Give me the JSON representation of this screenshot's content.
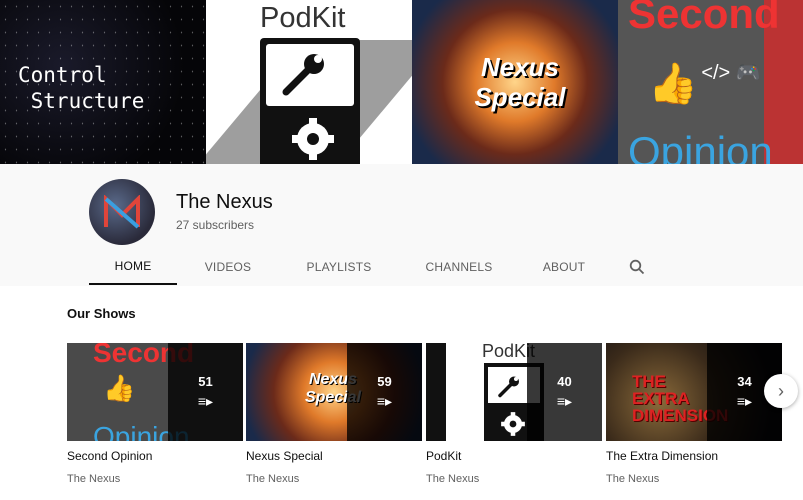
{
  "banner": {
    "tile1_text": "Control\n Structure",
    "tile2_text": "PodKit",
    "tile3_text": "Nexus Special",
    "tile4_top": "Second",
    "tile4_bottom": "Opinion",
    "tile4_icons": "</> 🎮"
  },
  "channel": {
    "name": "The Nexus",
    "subscribers": "27 subscribers"
  },
  "tabs": [
    {
      "label": "HOME"
    },
    {
      "label": "VIDEOS"
    },
    {
      "label": "PLAYLISTS"
    },
    {
      "label": "CHANNELS"
    },
    {
      "label": "ABOUT"
    }
  ],
  "section": {
    "title": "Our Shows"
  },
  "shows": [
    {
      "title": "Second Opinion",
      "channel": "The Nexus",
      "count": "51",
      "thumb_top": "Second",
      "thumb_bottom": "Opinion",
      "thumb_icons": "</> 🎮"
    },
    {
      "title": "Nexus Special",
      "channel": "The Nexus",
      "count": "59",
      "thumb_text": "Nexus Special"
    },
    {
      "title": "PodKit",
      "channel": "The Nexus",
      "count": "40",
      "thumb_text": "PodKit"
    },
    {
      "title": "The Extra Dimension",
      "channel": "The Nexus",
      "count": "34",
      "thumb_text": "THE EXTRA DIMENSION"
    }
  ]
}
